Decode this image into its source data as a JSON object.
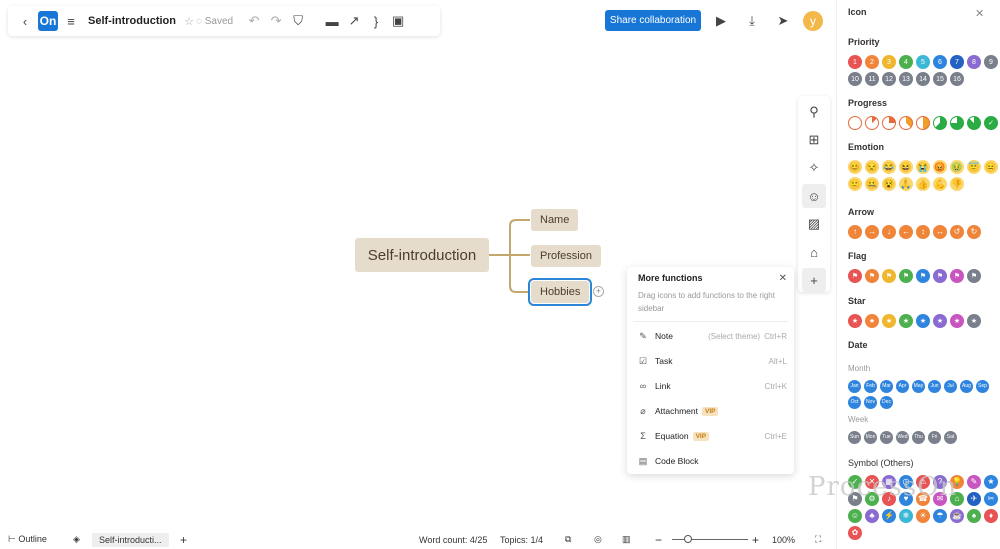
{
  "toolbar": {
    "logo": "On",
    "title": "Self-introduction",
    "saved": "Saved"
  },
  "header": {
    "share": "Share collaboration",
    "avatar": "y"
  },
  "mindmap": {
    "root": "Self-introduction",
    "children": [
      "Name",
      "Profession",
      "Hobbies"
    ]
  },
  "more_functions": {
    "title": "More functions",
    "desc": "Drag icons to add functions to the right sidebar",
    "items": [
      {
        "label": "Note",
        "hint": "(Select theme)",
        "shortcut": "Ctrl+R",
        "icon": "note-icon"
      },
      {
        "label": "Task",
        "shortcut": "Alt+L",
        "icon": "task-icon"
      },
      {
        "label": "Link",
        "shortcut": "Ctrl+K",
        "icon": "link-icon"
      },
      {
        "label": "Attachment",
        "vip": "VIP",
        "icon": "attachment-icon"
      },
      {
        "label": "Equation",
        "vip": "VIP",
        "shortcut": "Ctrl+E",
        "icon": "equation-icon"
      },
      {
        "label": "Code Block",
        "icon": "code-block-icon"
      }
    ]
  },
  "bottom": {
    "outline": "Outline",
    "tab": "Self-introducti...",
    "word_label": "Word count:",
    "word_value": "4/25",
    "topics_label": "Topics:",
    "topics_value": "1/4",
    "zoom": "100%",
    "zoom_level": 0.2
  },
  "panel": {
    "title": "Icon",
    "priority": {
      "label": "Priority",
      "items": [
        "1",
        "2",
        "3",
        "4",
        "5",
        "6",
        "7",
        "8",
        "9",
        "10",
        "11",
        "12",
        "13",
        "14",
        "15",
        "16"
      ],
      "colors": [
        "#e85454",
        "#f0853a",
        "#f0b62e",
        "#4cb04e",
        "#3cb7d6",
        "#2f85dd",
        "#2361c2",
        "#8a6bd1",
        "#7a7f8c",
        "#7a7f8c",
        "#7a7f8c",
        "#7a7f8c",
        "#7a7f8c",
        "#7a7f8c",
        "#7a7f8c",
        "#7a7f8c"
      ]
    },
    "progress": {
      "label": "Progress",
      "values": [
        0,
        0.125,
        0.25,
        0.375,
        0.5,
        0.625,
        0.75,
        0.875,
        1
      ]
    },
    "emotion": {
      "label": "Emotion",
      "items": [
        "😊",
        "😒",
        "😂",
        "😆",
        "😭",
        "😡",
        "🤢",
        "😇",
        "😐",
        "🙂",
        "🤐",
        "😵",
        "🙏",
        "👍",
        "💪",
        "👎"
      ]
    },
    "arrow": {
      "label": "Arrow",
      "items": [
        "↑",
        "→",
        "↓",
        "←",
        "↕",
        "↔",
        "↺",
        "↻"
      ]
    },
    "flag": {
      "label": "Flag",
      "colors": [
        "#e85454",
        "#f0853a",
        "#f0b62e",
        "#4cb04e",
        "#2f85dd",
        "#8a6bd1",
        "#c956c0",
        "#7a7f8c"
      ]
    },
    "star": {
      "label": "Star",
      "colors": [
        "#e85454",
        "#f0853a",
        "#f0b62e",
        "#4cb04e",
        "#2f85dd",
        "#8a6bd1",
        "#c956c0",
        "#7a7f8c"
      ]
    },
    "date": {
      "label": "Date",
      "month_label": "Month",
      "months": [
        "Jan",
        "Feb",
        "Mar",
        "Apr",
        "May",
        "Jun",
        "Jul",
        "Aug",
        "Sep",
        "Oct",
        "Nov",
        "Dec"
      ],
      "week_label": "Week",
      "weeks": [
        "Sun",
        "Mon",
        "Tue",
        "Wed",
        "Thu",
        "Fri",
        "Sat"
      ]
    },
    "symbol": {
      "label": "Symbol",
      "others": "(Others)",
      "items": [
        "✓",
        "✕",
        "▦",
        "◷",
        "⚠",
        "?",
        "💡",
        "✎",
        "★",
        "⚑",
        "⚙",
        "♪",
        "♥",
        "☎",
        "✉",
        "⌂",
        "✈",
        "✂",
        "☺",
        "♣",
        "⚡",
        "❄",
        "☀",
        "☂",
        "☕",
        "♠",
        "♦",
        "✿"
      ],
      "colors": [
        "#4cb04e",
        "#e85454",
        "#8a6bd1",
        "#2f85dd",
        "#e85454",
        "#8a6bd1",
        "#f0853a",
        "#c956c0",
        "#2f85dd",
        "#7a7f8c",
        "#4cb04e",
        "#e85454",
        "#2f85dd",
        "#f0853a",
        "#c956c0",
        "#4cb04e",
        "#2361c2",
        "#2f85dd",
        "#4cb04e",
        "#8a6bd1",
        "#2f85dd",
        "#3cb7d6",
        "#f0853a",
        "#2f85dd",
        "#8a6bd1",
        "#4cb04e",
        "#e85454",
        "#e85454"
      ]
    }
  },
  "watermark": "ProcessOn"
}
